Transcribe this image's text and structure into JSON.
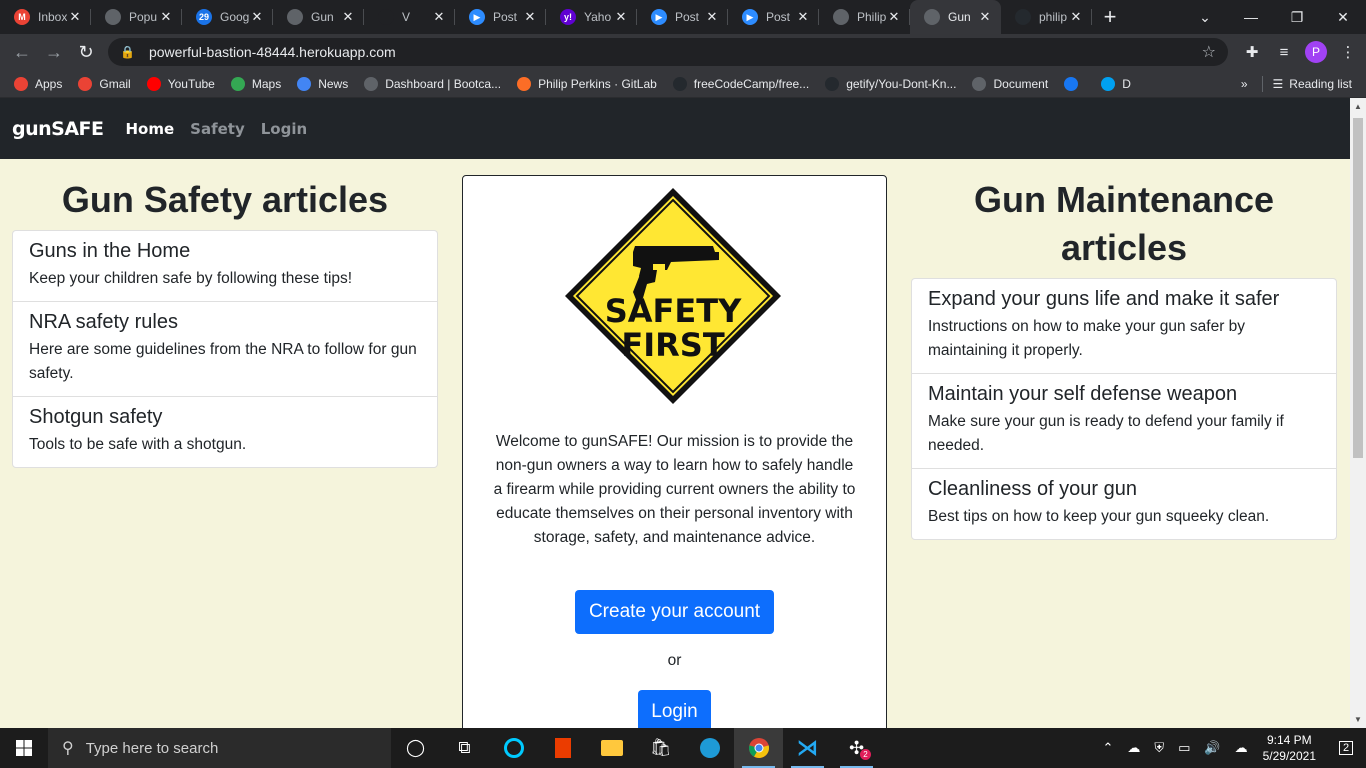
{
  "browser": {
    "tabs": [
      {
        "title": "Inbox",
        "icon": "gmail-icon",
        "icon_color": "#ea4335",
        "icon_glyph": "M",
        "active": false
      },
      {
        "title": "Popu",
        "icon": "globe-icon",
        "icon_color": "#5f6368",
        "icon_glyph": "",
        "active": false
      },
      {
        "title": "Goog",
        "icon": "calendar-icon",
        "icon_color": "#1a73e8",
        "icon_glyph": "29",
        "active": false
      },
      {
        "title": "Gun",
        "icon": "globe-icon",
        "icon_color": "#5f6368",
        "icon_glyph": "",
        "active": false
      },
      {
        "title": "V",
        "icon": "speaker-icon",
        "icon_color": "#202124",
        "icon_glyph": "",
        "active": false
      },
      {
        "title": "Post",
        "icon": "zoom-icon",
        "icon_color": "#2d8cff",
        "icon_glyph": "▶",
        "active": false
      },
      {
        "title": "Yaho",
        "icon": "yahoo-icon",
        "icon_color": "#6001d2",
        "icon_glyph": "y!",
        "active": false
      },
      {
        "title": "Post",
        "icon": "zoom-icon",
        "icon_color": "#2d8cff",
        "icon_glyph": "▶",
        "active": false
      },
      {
        "title": "Post",
        "icon": "zoom-icon",
        "icon_color": "#2d8cff",
        "icon_glyph": "▶",
        "active": false
      },
      {
        "title": "Philip",
        "icon": "globe-icon",
        "icon_color": "#5f6368",
        "icon_glyph": "",
        "active": false
      },
      {
        "title": "Gun",
        "icon": "globe-icon",
        "icon_color": "#5f6368",
        "icon_glyph": "",
        "active": true
      },
      {
        "title": "philip",
        "icon": "github-icon",
        "icon_color": "#24292e",
        "icon_glyph": "",
        "active": false
      }
    ],
    "url": "powerful-bastion-48444.herokuapp.com",
    "bookmarks": [
      {
        "label": "Apps",
        "icon": "apps-grid-icon",
        "color": "#ea4335"
      },
      {
        "label": "Gmail",
        "icon": "gmail-icon",
        "color": "#ea4335"
      },
      {
        "label": "YouTube",
        "icon": "youtube-icon",
        "color": "#ff0000"
      },
      {
        "label": "Maps",
        "icon": "maps-icon",
        "color": "#34a853"
      },
      {
        "label": "News",
        "icon": "news-icon",
        "color": "#4285f4"
      },
      {
        "label": "Dashboard | Bootca...",
        "icon": "globe-icon",
        "color": "#5f6368"
      },
      {
        "label": "Philip Perkins · GitLab",
        "icon": "gitlab-icon",
        "color": "#fc6d26"
      },
      {
        "label": "freeCodeCamp/free...",
        "icon": "github-icon",
        "color": "#24292e"
      },
      {
        "label": "getify/You-Dont-Kn...",
        "icon": "github-icon",
        "color": "#24292e"
      },
      {
        "label": "Document",
        "icon": "globe-icon",
        "color": "#5f6368"
      },
      {
        "label": "",
        "icon": "facebook-icon",
        "color": "#1877f2"
      },
      {
        "label": "D",
        "icon": "chat-icon",
        "color": "#00a1f1"
      }
    ],
    "reading_list": "Reading list",
    "profile_initial": "P"
  },
  "site": {
    "brand": "gunSAFE",
    "nav": {
      "home": "Home",
      "safety": "Safety",
      "login": "Login"
    },
    "left": {
      "title": "Gun Safety articles",
      "items": [
        {
          "title": "Guns in the Home",
          "desc": "Keep your children safe by following these tips!"
        },
        {
          "title": "NRA safety rules",
          "desc": "Here are some guidelines from the NRA to follow for gun safety."
        },
        {
          "title": "Shotgun safety",
          "desc": "Tools to be safe with a shotgun."
        }
      ]
    },
    "center": {
      "logo_line1": "SAFETY",
      "logo_line2": "FIRST",
      "welcome": "Welcome to gunSAFE! Our mission is to provide the non-gun owners a way to learn how to safely handle a firearm while providing current owners the ability to educate themselves on their personal inventory with storage, safety, and maintenance advice.",
      "create_button": "Create your account",
      "or": "or",
      "login_button": "Login"
    },
    "right": {
      "title": "Gun Maintenance articles",
      "items": [
        {
          "title": "Expand your guns life and make it safer",
          "desc": "Instructions on how to make your gun safer by maintaining it properly."
        },
        {
          "title": "Maintain your self defense weapon",
          "desc": "Make sure your gun is ready to defend your family if needed."
        },
        {
          "title": "Cleanliness of your gun",
          "desc": "Best tips on how to keep your gun squeeky clean."
        }
      ]
    }
  },
  "taskbar": {
    "search_placeholder": "Type here to search",
    "time": "9:14 PM",
    "date": "5/29/2021",
    "notification_count": "2",
    "slack_badge": "2"
  }
}
